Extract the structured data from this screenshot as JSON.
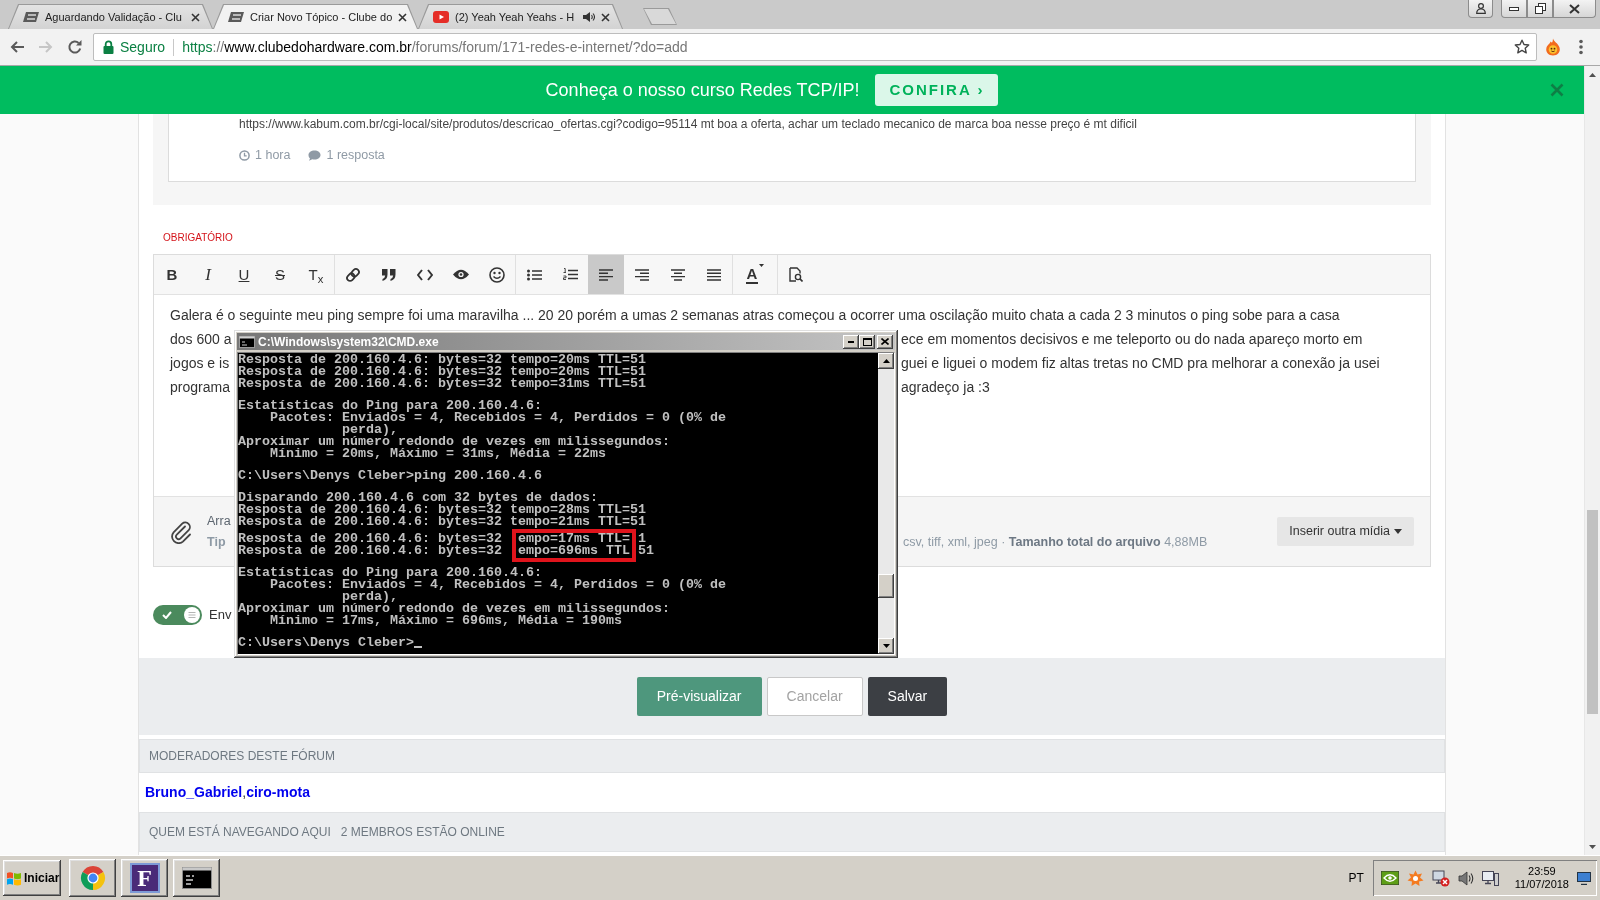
{
  "browser": {
    "tabs": [
      {
        "title": "Aguardando Validação - Clu",
        "kind": "site",
        "audio": false,
        "selected": false
      },
      {
        "title": "Criar Novo Tópico - Clube do",
        "kind": "site",
        "audio": false,
        "selected": true
      },
      {
        "title": "(2) Yeah Yeah Yeahs - H",
        "kind": "video",
        "audio": true,
        "selected": false
      }
    ],
    "nav_buttons": [
      {
        "disabled": false
      },
      {
        "disabled": true
      },
      {
        "disabled": false
      }
    ],
    "security": "Seguro",
    "url": [
      {
        "text": "https",
        "kind": "scheme"
      },
      {
        "text": "://",
        "kind": "dim"
      },
      {
        "text": "www.clubedohardware.com.br",
        "kind": "host"
      },
      {
        "text": "/forums/forum/171-redes-e-internet/?do=add",
        "kind": "dim"
      }
    ],
    "bookmarked": false
  },
  "banner": {
    "text": "Conheça o nosso curso Redes TCP/IP!",
    "button": "CONFIRA ›"
  },
  "previous_post": {
    "text": "https://www.kabum.com.br/cgi-local/site/produtos/descricao_ofertas.cgi?codigo=95114 mt boa a oferta, achar um teclado mecanico de marca boa nesse preço é mt dificil",
    "time": "1 hora",
    "replies": "1 resposta"
  },
  "editor": {
    "required_label": "OBRIGATÓRIO",
    "toolbar_groups": [
      {
        "buttons": [
          {
            "kind": "glyph",
            "glyph": "B",
            "selected": false
          },
          {
            "kind": "glyph",
            "glyph": "I",
            "selected": false
          },
          {
            "kind": "glyph",
            "glyph": "U",
            "selected": false
          },
          {
            "kind": "glyph",
            "glyph": "S",
            "selected": false
          },
          {
            "kind": "glyph",
            "glyph": "T$_{x}$",
            "selected": false
          }
        ]
      },
      {
        "buttons": [
          {
            "kind": "icon",
            "selected": false
          },
          {
            "kind": "icon",
            "selected": false
          },
          {
            "kind": "icon",
            "selected": false
          },
          {
            "kind": "icon",
            "selected": false
          },
          {
            "kind": "icon",
            "selected": false
          }
        ]
      },
      {
        "buttons": [
          {
            "kind": "icon",
            "selected": false
          },
          {
            "kind": "icon",
            "selected": false
          },
          {
            "kind": "icon",
            "selected": true
          },
          {
            "kind": "icon",
            "selected": false
          },
          {
            "kind": "icon",
            "selected": false
          },
          {
            "kind": "icon",
            "selected": false
          }
        ]
      },
      {
        "buttons": [
          {
            "kind": "glyph",
            "glyph": "A",
            "dropdown": true,
            "selected": false
          }
        ]
      },
      {
        "buttons": [
          {
            "kind": "icon",
            "selected": false
          }
        ]
      }
    ],
    "body_lines": [
      {
        "segments": [
          "Galera é o seguinte meu ping sempre foi uma maravilha ... 20 20 porém a umas 2 semanas atras começou a ocorrer uma oscilação muito chata a cada 2 3 minutos o ping sobe para a casa"
        ]
      },
      {
        "segments": [
          "dos 600 a",
          "ece em momentos decisivos e me teleporto ou do nada apareço morto em"
        ]
      },
      {
        "segments": [
          "jogos e is",
          "guei e liguei o modem fiz altas tretas no CMD pra melhorar a conexão ja usei"
        ]
      },
      {
        "segments": [
          "programa",
          "agradeço ja :3"
        ]
      }
    ],
    "attachments": {
      "drop_text": "Arra",
      "types_label": "Tip",
      "types_rest": "csv, tiff, xml, jpeg · **Tamanho total do arquivo** 4,88MB",
      "button": "Inserir outra mídia"
    },
    "notify": {
      "on": true,
      "label": "Env"
    }
  },
  "console": {
    "title": "C:\\Windows\\system32\\CMD.exe",
    "cursor": true,
    "blocks": [
      [
        {
          "kind": "plain",
          "segments": [
            "Resposta de 200.160.4.6: bytes=32 tempo=20ms TTL=51"
          ],
          "boxed": false
        },
        {
          "kind": "plain",
          "segments": [
            "Resposta de 200.160.4.6: bytes=32 tempo=20ms TTL=51"
          ],
          "boxed": false
        },
        {
          "kind": "plain",
          "segments": [
            "Resposta de 200.160.4.6: bytes=32 tempo=31ms TTL=51"
          ],
          "boxed": false
        }
      ],
      [
        {
          "kind": "plain",
          "segments": [
            "Estatísticas do Ping para 200.160.4.6:"
          ],
          "boxed": false
        },
        {
          "kind": "indent",
          "segments": [
            "Pacotes: Enviados = 4, Recebidos = 4, Perdidos = 0 (0% de"
          ],
          "boxed": false
        },
        {
          "kind": "wrap",
          "segments": [
            "perda),"
          ],
          "boxed": false
        },
        {
          "kind": "plain",
          "segments": [
            "Aproximar um número redondo de vezes em milissegundos:"
          ],
          "boxed": false
        },
        {
          "kind": "indent",
          "segments": [
            "Mínimo = 20ms, Máximo = 31ms, Média = 22ms"
          ],
          "boxed": false
        }
      ],
      [
        {
          "kind": "plain",
          "segments": [
            "C:\\Users\\Denys Cleber>ping 200.160.4.6"
          ],
          "boxed": false
        }
      ],
      [
        {
          "kind": "plain",
          "segments": [
            "Disparando 200.160.4.6 com 32 bytes de dados:"
          ],
          "boxed": false
        },
        {
          "kind": "plain",
          "segments": [
            "Resposta de 200.160.4.6: bytes=32 tempo=28ms TTL=51"
          ],
          "boxed": false
        },
        {
          "kind": "plain",
          "segments": [
            "Resposta de 200.160.4.6: bytes=32 tempo=21ms TTL=51"
          ],
          "boxed": false
        },
        {
          "kind": "plain",
          "segments": [
            "Resposta de 200.160.4.6: bytes=32 ",
            "empo=17ms TTL=",
            "1"
          ],
          "boxed": true
        },
        {
          "kind": "plain",
          "segments": [
            "Resposta de 200.160.4.6: bytes=32 ",
            "empo=696ms TTL",
            "51"
          ],
          "boxed": true
        }
      ],
      [
        {
          "kind": "plain",
          "segments": [
            "Estatísticas do Ping para 200.160.4.6:"
          ],
          "boxed": false
        },
        {
          "kind": "indent",
          "segments": [
            "Pacotes: Enviados = 4, Recebidos = 4, Perdidos = 0 (0% de"
          ],
          "boxed": false
        },
        {
          "kind": "wrap",
          "segments": [
            "perda),"
          ],
          "boxed": false
        },
        {
          "kind": "plain",
          "segments": [
            "Aproximar um número redondo de vezes em milissegundos:"
          ],
          "boxed": false
        },
        {
          "kind": "indent",
          "segments": [
            "Mínimo = 17ms, Máximo = 696ms, Média = 190ms"
          ],
          "boxed": false
        }
      ],
      [
        {
          "kind": "plain",
          "segments": [
            "C:\\Users\\Denys Cleber>"
          ],
          "boxed": false
        }
      ]
    ]
  },
  "actions": [
    {
      "label": "Pré-visualizar",
      "kind": "primary"
    },
    {
      "label": "Cancelar",
      "kind": "outline"
    },
    {
      "label": "Salvar",
      "kind": "dark"
    }
  ],
  "moderators": {
    "heading": "MODERADORES DESTE FÓRUM",
    "names": [
      "Bruno_Gabriel",
      "ciro-mota"
    ],
    "separator": ","
  },
  "online": {
    "heading": "QUEM ESTÁ NAVEGANDO AQUI",
    "count": "2 MEMBROS ESTÃO ONLINE"
  },
  "taskbar": {
    "start": "Iniciar",
    "apps": [
      {
        "kind": "logo"
      },
      {
        "kind": "glyph",
        "glyph": "F"
      },
      {
        "kind": "console"
      }
    ],
    "language": "PT",
    "time": "23:59",
    "date": "11/07/2018"
  }
}
